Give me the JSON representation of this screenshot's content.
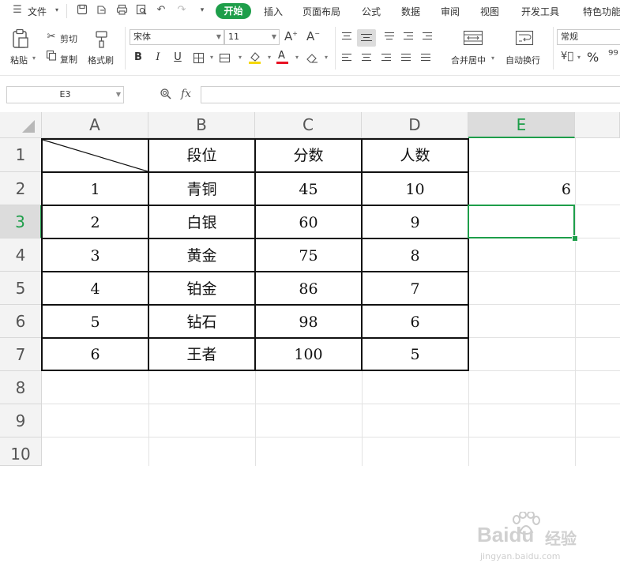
{
  "menu": {
    "file_label": "文件",
    "tabs": [
      "开始",
      "插入",
      "页面布局",
      "公式",
      "数据",
      "审阅",
      "视图",
      "开发工具",
      "特色功能"
    ],
    "active_tab": "开始"
  },
  "ribbon": {
    "paste_label": "粘贴",
    "cut_label": "剪切",
    "copy_label": "复制",
    "format_painter_label": "格式刷",
    "font_name": "宋体",
    "font_size": "11",
    "merge_label": "合并居中",
    "wrap_label": "自动换行",
    "number_format": "常规",
    "percent_symbol": "%",
    "colors": {
      "highlight": "#f5d800",
      "font_color": "#e81123"
    }
  },
  "formula_bar": {
    "cell_ref": "E3",
    "fx_label": "fx",
    "formula": ""
  },
  "sheet": {
    "columns": [
      "A",
      "B",
      "C",
      "D",
      "E"
    ],
    "rows": [
      "1",
      "2",
      "3",
      "4",
      "5",
      "6",
      "7",
      "8",
      "9",
      "10"
    ],
    "selected_column": "E",
    "selected_row": "3",
    "accent_color": "#1e9e4a",
    "table": {
      "headers": [
        "段位",
        "分数",
        "人数"
      ],
      "rows": [
        [
          "1",
          "青铜",
          "45",
          "10"
        ],
        [
          "2",
          "白银",
          "60",
          "9"
        ],
        [
          "3",
          "黄金",
          "75",
          "8"
        ],
        [
          "4",
          "铂金",
          "86",
          "7"
        ],
        [
          "5",
          "钻石",
          "98",
          "6"
        ],
        [
          "6",
          "王者",
          "100",
          "5"
        ]
      ]
    },
    "e2_value": "6"
  },
  "watermark": {
    "brand": "Baidu",
    "suffix": "经验",
    "url": "jingyan.baidu.com"
  }
}
